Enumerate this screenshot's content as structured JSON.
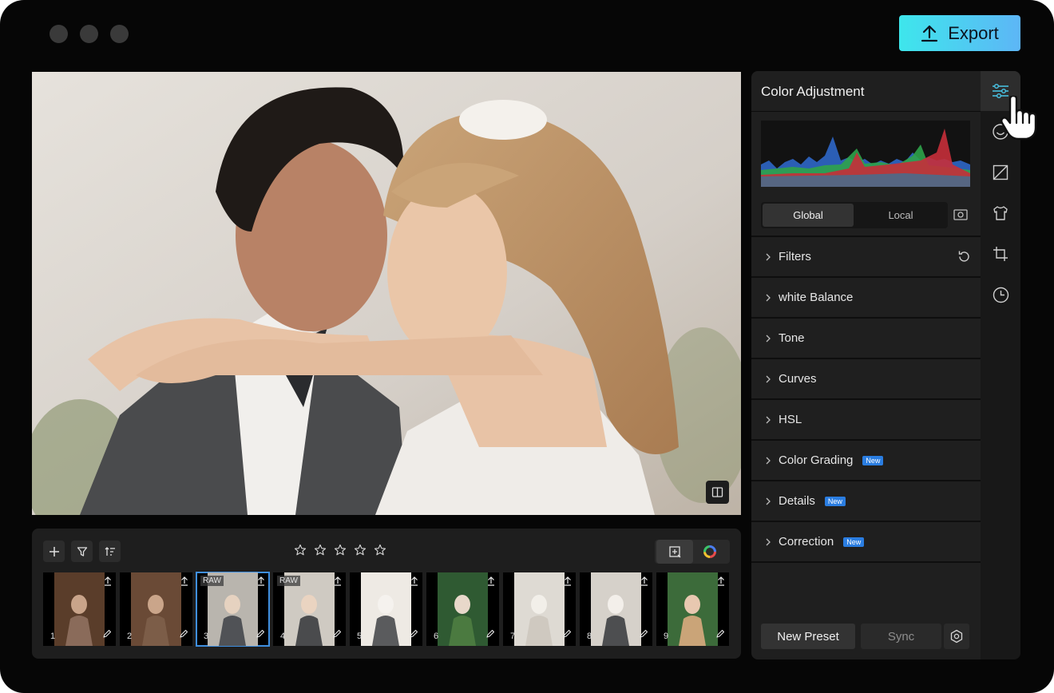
{
  "window": {
    "controls": [
      "close",
      "minimize",
      "maximize"
    ]
  },
  "toolbar": {
    "export_label": "Export",
    "export_icon": "upload-icon"
  },
  "viewer": {
    "compare_icon": "compare-icon"
  },
  "filmstrip": {
    "tools": [
      "add-icon",
      "filter-icon",
      "sort-icon"
    ],
    "rating": {
      "max": 5,
      "value": 0
    },
    "right_tools": [
      "add-photo-icon",
      "color-wheel-icon"
    ],
    "thumbnails": [
      {
        "number": "1",
        "raw": "",
        "selected": false
      },
      {
        "number": "2",
        "raw": "",
        "selected": false
      },
      {
        "number": "3",
        "raw": "RAW",
        "selected": true
      },
      {
        "number": "4",
        "raw": "RAW",
        "selected": false
      },
      {
        "number": "5",
        "raw": "",
        "selected": false
      },
      {
        "number": "6",
        "raw": "",
        "selected": false
      },
      {
        "number": "7",
        "raw": "",
        "selected": false
      },
      {
        "number": "8",
        "raw": "",
        "selected": false
      },
      {
        "number": "9",
        "raw": "",
        "selected": false
      }
    ]
  },
  "panel": {
    "title": "Color Adjustment",
    "tabs": {
      "global": "Global",
      "local": "Local",
      "active": "Global"
    },
    "sections": [
      {
        "label": "Filters",
        "badge": "",
        "reset": true
      },
      {
        "label": "white Balance",
        "badge": ""
      },
      {
        "label": "Tone",
        "badge": ""
      },
      {
        "label": "Curves",
        "badge": ""
      },
      {
        "label": "HSL",
        "badge": ""
      },
      {
        "label": "Color Grading",
        "badge": "New"
      },
      {
        "label": "Details",
        "badge": "New"
      },
      {
        "label": "Correction",
        "badge": "New"
      }
    ],
    "new_preset_label": "New Preset",
    "sync_label": "Sync"
  },
  "rail": {
    "icons": [
      "sliders-icon",
      "face-retouch-icon",
      "tone-curve-icon",
      "shirt-icon",
      "crop-icon",
      "history-icon"
    ],
    "active": "sliders-icon"
  },
  "colors": {
    "accent_start": "#3ee6ec",
    "accent_end": "#5db6f6",
    "selection": "#3f8fe0",
    "badge": "#2a7de1"
  }
}
